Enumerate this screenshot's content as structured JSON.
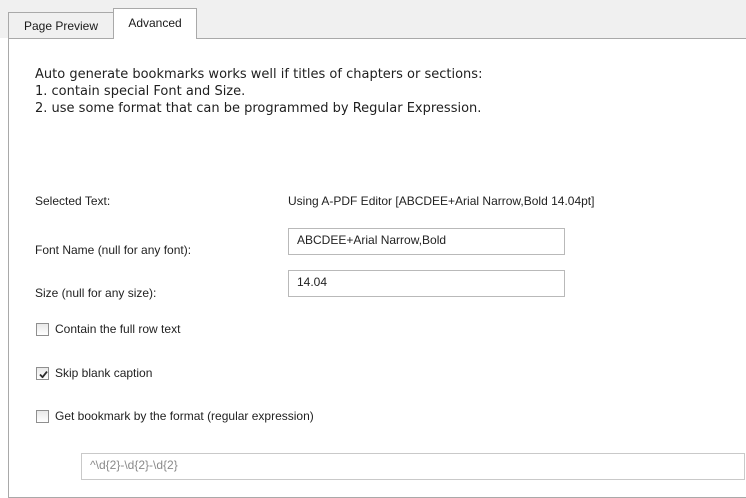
{
  "tabs": [
    {
      "label": "Page Preview",
      "active": false
    },
    {
      "label": "Advanced",
      "active": true
    }
  ],
  "intro": {
    "line1": "Auto generate bookmarks works well if titles of chapters or sections:",
    "line2": "1. contain special Font and Size.",
    "line3": "2. use some format that can be programmed by Regular Expression."
  },
  "selected_text": {
    "label": "Selected Text:",
    "value": "Using A-PDF Editor  [ABCDEE+Arial Narrow,Bold 14.04pt]"
  },
  "font_name": {
    "label": "Font Name (null for any font):",
    "value": "ABCDEE+Arial Narrow,Bold"
  },
  "size": {
    "label": "Size (null for any size):",
    "value": "14.04"
  },
  "options": {
    "full_row": {
      "label": "Contain the full row text",
      "checked": false
    },
    "skip_blank": {
      "label": "Skip blank caption",
      "checked": true
    },
    "by_format": {
      "label": "Get bookmark by the format (regular expression)",
      "checked": false
    }
  },
  "regex": {
    "value": "^\\d{2}-\\d{2}-\\d{2}"
  }
}
